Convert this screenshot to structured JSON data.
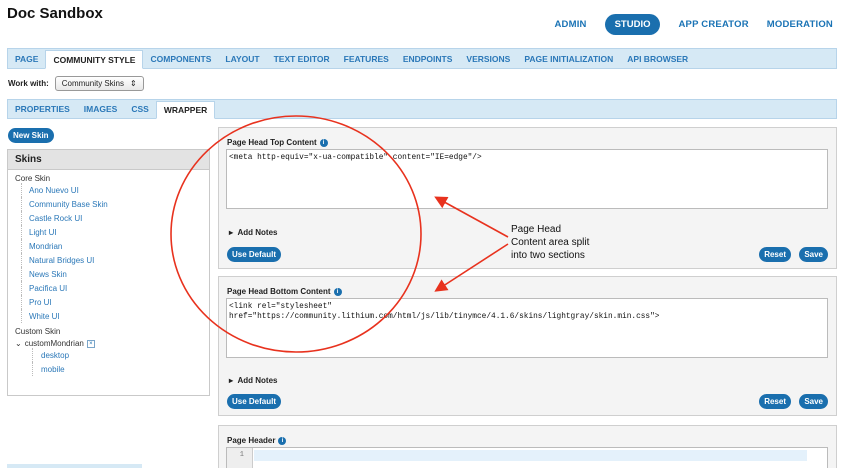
{
  "app": {
    "title": "Doc Sandbox"
  },
  "topnav": {
    "admin": "ADMIN",
    "studio": "STUDIO",
    "app_creator": "APP CREATOR",
    "moderation": "MODERATION"
  },
  "main_tabs": [
    {
      "label": "PAGE",
      "active": false
    },
    {
      "label": "COMMUNITY STYLE",
      "active": true
    },
    {
      "label": "COMPONENTS",
      "active": false
    },
    {
      "label": "LAYOUT",
      "active": false
    },
    {
      "label": "TEXT EDITOR",
      "active": false
    },
    {
      "label": "FEATURES",
      "active": false
    },
    {
      "label": "ENDPOINTS",
      "active": false
    },
    {
      "label": "VERSIONS",
      "active": false
    },
    {
      "label": "PAGE INITIALIZATION",
      "active": false
    },
    {
      "label": "API BROWSER",
      "active": false
    }
  ],
  "work_with": {
    "label": "Work with:",
    "value": "Community Skins",
    "arrow": "⇕"
  },
  "sub_tabs": [
    {
      "label": "PROPERTIES",
      "active": false
    },
    {
      "label": "IMAGES",
      "active": false
    },
    {
      "label": "CSS",
      "active": false
    },
    {
      "label": "WRAPPER",
      "active": true
    }
  ],
  "new_skin_label": "New Skin",
  "skins": {
    "header": "Skins",
    "core_label": "Core Skin",
    "core_items": [
      "Ano Nuevo UI",
      "Community Base Skin",
      "Castle Rock UI",
      "Light UI",
      "Mondrian",
      "Natural Bridges UI",
      "News Skin",
      "Pacifica UI",
      "Pro UI",
      "White UI"
    ],
    "custom_label": "Custom Skin",
    "custom_skin": {
      "name": "customMondrian",
      "toggle": "⌄",
      "remove": "×",
      "children": [
        "desktop",
        "mobile"
      ]
    }
  },
  "panels": {
    "top": {
      "label": "Page Head Top Content",
      "code": "<meta http-equiv=\"x-ua-compatible\" content=\"IE=edge\"/>",
      "notes": "Add Notes",
      "use_default": "Use Default",
      "reset": "Reset",
      "save": "Save"
    },
    "bottom": {
      "label": "Page Head Bottom Content",
      "code": "<link rel=\"stylesheet\"\nhref=\"https://community.lithium.com/html/js/lib/tinymce/4.1.6/skins/lightgray/skin.min.css\">",
      "notes": "Add Notes",
      "use_default": "Use Default",
      "reset": "Reset",
      "save": "Save"
    },
    "header": {
      "label": "Page Header",
      "line_number": "1"
    }
  },
  "glyphs": {
    "info": "i",
    "triangle": "▸"
  },
  "annotation": {
    "text_line1": "Page Head",
    "text_line2": "Content area split",
    "text_line3": "into two sections",
    "color": "#e8321e"
  }
}
